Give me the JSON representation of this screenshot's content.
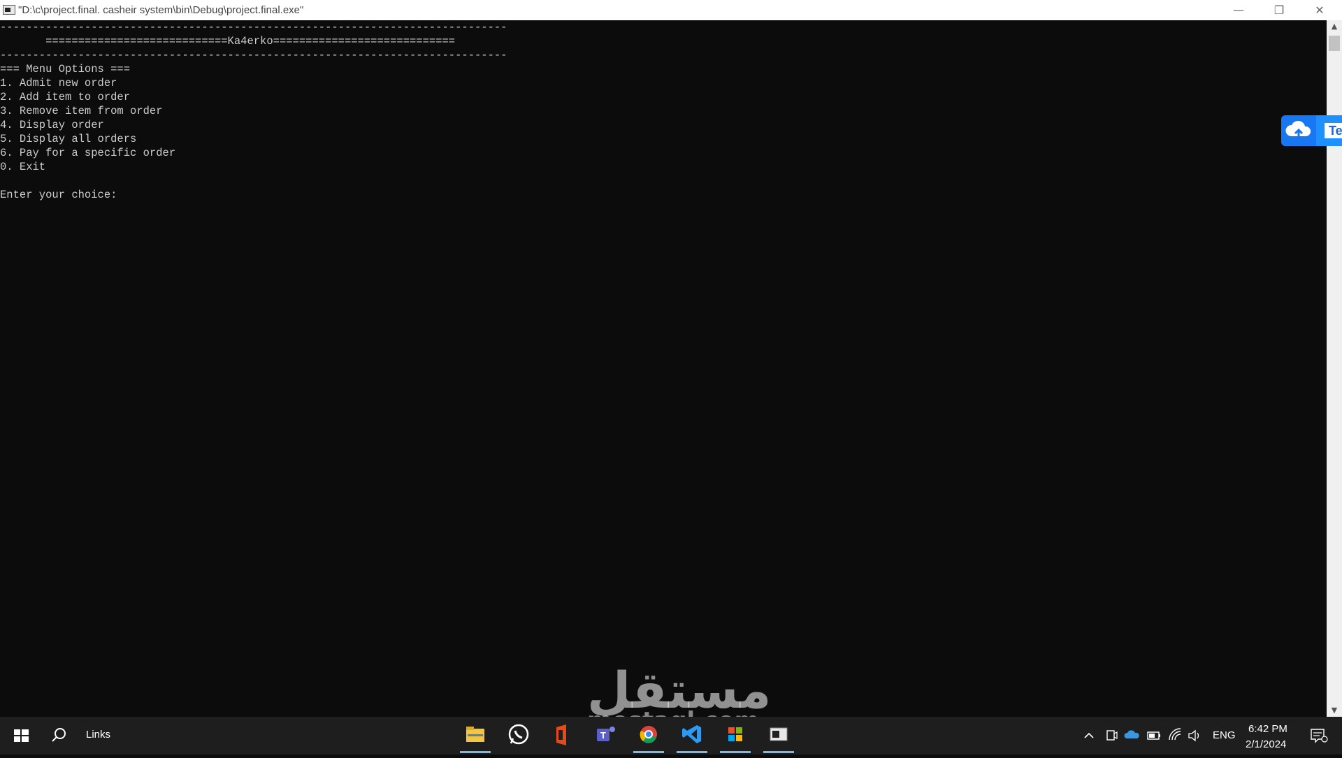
{
  "window": {
    "title": "\"D:\\c\\project.final. casheir system\\bin\\Debug\\project.final.exe\"",
    "minimize_glyph": "—",
    "restore_glyph": "❐",
    "close_glyph": "✕"
  },
  "console": {
    "lines": [
      "------------------------------------------------------------------------------",
      "       ============================Ka4erko============================",
      "------------------------------------------------------------------------------",
      "=== Menu Options ===",
      "1. Admit new order",
      "2. Add item to order",
      "3. Remove item from order",
      "4. Display order",
      "5. Display all orders",
      "6. Pay for a specific order",
      "0. Exit",
      "",
      "Enter your choice: "
    ]
  },
  "upload_widget": {
    "icon": "cloud-upload-icon",
    "label": "Te"
  },
  "watermark": {
    "arabic": "مستقل",
    "latin": "mostaql.com"
  },
  "taskbar": {
    "search_label": "Links",
    "pinned": [
      {
        "name": "file-explorer-icon",
        "active": true
      },
      {
        "name": "whatsapp-icon",
        "active": false
      },
      {
        "name": "office-icon",
        "active": false
      },
      {
        "name": "teams-icon",
        "active": false
      },
      {
        "name": "chrome-icon",
        "active": true
      },
      {
        "name": "vscode-icon",
        "active": true
      },
      {
        "name": "visual-studio-installer-icon",
        "active": true
      },
      {
        "name": "console-window-icon",
        "active": true
      }
    ],
    "tray": {
      "language": "ENG",
      "time": "6:42 PM",
      "date": "2/1/2024"
    }
  },
  "colors": {
    "console_bg": "#0c0c0c",
    "console_fg": "#cccccc",
    "taskbar_bg": "#1e1e1e",
    "accent": "#76b9ed"
  }
}
